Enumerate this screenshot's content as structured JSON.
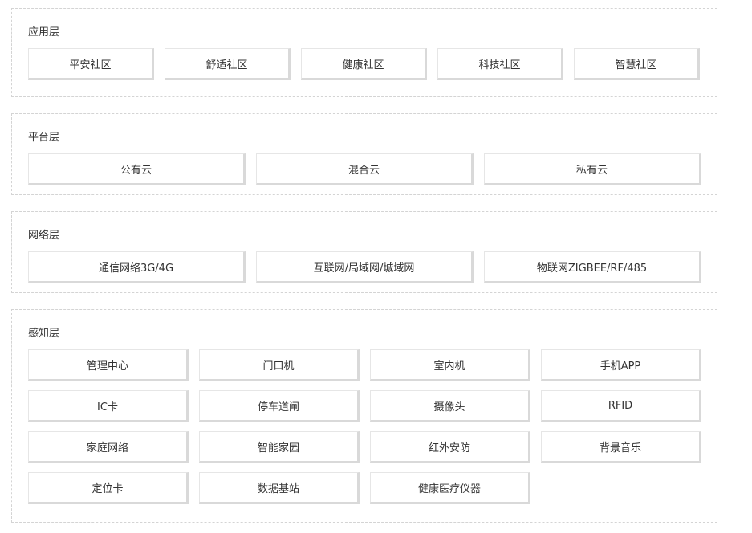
{
  "layers": [
    {
      "title": "应用层",
      "items": [
        "平安社区",
        "舒适社区",
        "健康社区",
        "科技社区",
        "智慧社区"
      ]
    },
    {
      "title": "平台层",
      "items": [
        "公有云",
        "混合云",
        "私有云"
      ]
    },
    {
      "title": "网络层",
      "items": [
        "通信网络3G/4G",
        "互联网/局域网/城域网",
        "物联网ZIGBEE/RF/485"
      ]
    },
    {
      "title": "感知层",
      "items": [
        "管理中心",
        "门口机",
        "室内机",
        "手机APP",
        "IC卡",
        "停车道闸",
        "摄像头",
        "RFID",
        "家庭网络",
        "智能家园",
        "红外安防",
        "背景音乐",
        "定位卡",
        "数据基站",
        "健康医疗仪器"
      ]
    }
  ]
}
